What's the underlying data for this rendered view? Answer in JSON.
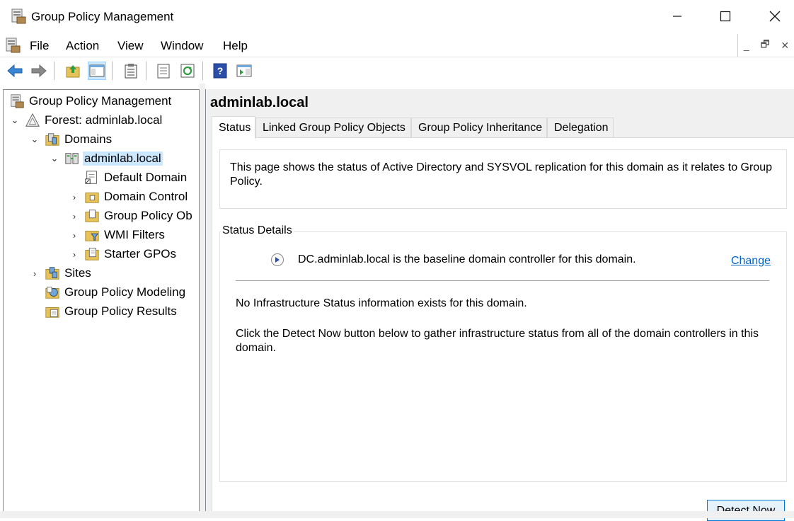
{
  "window": {
    "title": "Group Policy Management",
    "minimize": "—",
    "maximize": "☐",
    "close": "✕"
  },
  "menu": {
    "items": [
      "File",
      "Action",
      "View",
      "Window",
      "Help"
    ]
  },
  "mdi": {
    "min": "_",
    "restore": "🗗",
    "close": "✕"
  },
  "tree": {
    "root": "Group Policy Management",
    "forest": "Forest: adminlab.local",
    "domains": "Domains",
    "domain": "adminlab.local",
    "default_domain": "Default Domain",
    "domain_controllers": "Domain Control",
    "gpo": "Group Policy Ob",
    "wmi": "WMI Filters",
    "starter": "Starter GPOs",
    "sites": "Sites",
    "modeling": "Group Policy Modeling",
    "results": "Group Policy Results"
  },
  "content": {
    "title": "adminlab.local",
    "tabs": [
      "Status",
      "Linked Group Policy Objects",
      "Group Policy Inheritance",
      "Delegation"
    ],
    "description": "This page shows the status of Active Directory and SYSVOL replication for this domain as it relates to Group Policy.",
    "status_details_label": "Status Details",
    "dc_text": "DC.adminlab.local is the baseline domain controller for this domain.",
    "change_link": "Change",
    "no_info": "No Infrastructure Status information exists for this domain.",
    "click_info": "Click the Detect Now button below to gather infrastructure status from all of the domain controllers in this domain.",
    "detect_button": "Detect Now"
  }
}
